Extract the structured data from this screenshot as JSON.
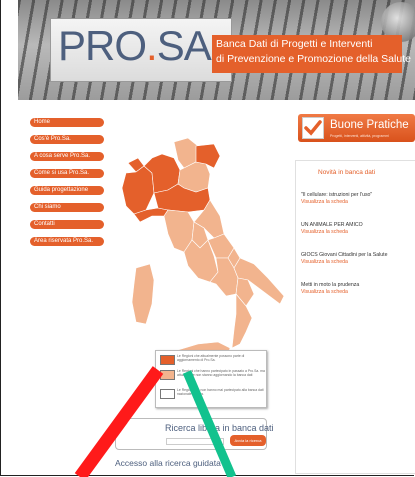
{
  "header": {
    "logo_prefix": "PRO",
    "logo_o": ".",
    "logo_suffix": "SA.",
    "title_line1": "Banca Dati di Progetti e Interventi",
    "title_line2": "di Prevenzione e Promozione della Salute"
  },
  "sidebar": {
    "items": [
      {
        "label": "Home"
      },
      {
        "label": "Cos'è Pro.Sa."
      },
      {
        "label": "A cosa serve Pro.Sa."
      },
      {
        "label": "Come si usa Pro.Sa."
      },
      {
        "label": "Guida progettazione"
      },
      {
        "label": "Chi siamo"
      },
      {
        "label": "Contatti"
      },
      {
        "label": "Area riservata Pro.Sa."
      }
    ]
  },
  "buone_pratiche": {
    "title": "Buone Pratiche",
    "subtitle": "Progetti, interventi, attività, programmi"
  },
  "news": {
    "title": "Novità in banca dati",
    "items": [
      {
        "title": "\"Il cellulare: istruzioni per l'uso\"",
        "link": "Visualizza la scheda"
      },
      {
        "title": "UN ANIMALE PER AMICO",
        "link": "Visualizza la scheda"
      },
      {
        "title": "GIOCS Giovani Cittadini per la Salute",
        "link": "Visualizza la scheda"
      },
      {
        "title": "Metti in moto la prudenza",
        "link": "Visualizza la scheda"
      }
    ]
  },
  "legend": {
    "items": [
      {
        "color": "#e4602b",
        "text": "Le Regioni che attualmente possono parte di aggiornamento di Pro.Sa."
      },
      {
        "color": "#f2b48e",
        "text": "Le Regioni che hanno partecipato in passato a Pro.Sa. ma attualmente non stanno aggiornando la banca dati"
      },
      {
        "color": "#ffffff",
        "text": "Le Regioni che non hanno mai partecipato alla banca dati nazionale Pro.Sa."
      }
    ]
  },
  "search": {
    "title": "Ricerca libera in banca dati",
    "button": "Avvia la ricerca",
    "advanced_link": "Accesso alla ricerca guidata"
  },
  "colors": {
    "accent": "#e4602b",
    "region_active": "#e4602b",
    "region_past": "#f2b48e",
    "annotation_red": "#ff1a1a",
    "annotation_green": "#12c28e"
  }
}
